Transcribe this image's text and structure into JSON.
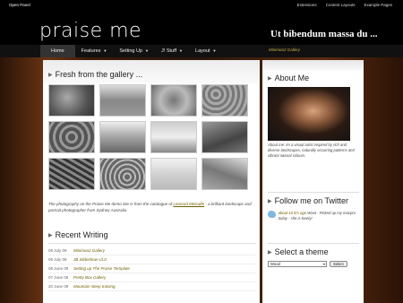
{
  "topbar": {
    "open_panel": "Open Panel",
    "links": [
      "Extensions",
      "Content Layouts",
      "Example Pages"
    ]
  },
  "header": {
    "logo": "praise me",
    "tagline": "Ut bibendum massa du ..."
  },
  "nav": {
    "items": [
      {
        "label": "Home",
        "active": true,
        "dropdown": false
      },
      {
        "label": "Features",
        "active": false,
        "dropdown": true
      },
      {
        "label": "Setting Up",
        "active": false,
        "dropdown": true
      },
      {
        "label": "J! Stuff",
        "active": false,
        "dropdown": true
      },
      {
        "label": "Layout",
        "active": false,
        "dropdown": true
      }
    ],
    "breadcrumb": "Minimoo2 Gallery"
  },
  "main": {
    "gallery_title": "Fresh from the gallery ...",
    "description_before": "The photography on the Praise Me demo site is from the catalogue of ",
    "description_link": "Leonard Metcalfe",
    "description_after": " - a brilliant landscape and portrait photographer from Sydney Australia.",
    "recent_title": "Recent Writing",
    "posts": [
      {
        "date": "09 July 09",
        "title": "Minimoo2 Gallery"
      },
      {
        "date": "09 July 09",
        "title": "JB Slideshow v3.0"
      },
      {
        "date": "08 June 09",
        "title": "Setting up The Praise Template"
      },
      {
        "date": "07 June 09",
        "title": "Pretty Box Gallery"
      },
      {
        "date": "20 June 09",
        "title": "Mountain sleep training"
      }
    ]
  },
  "sidebar": {
    "about_title": "About Me",
    "about_text": "About me: Im a visual artist inspired by rich and diverse landscapes, naturally occurring patterns and vibrant natural colours.",
    "twitter_title": "Follow me on Twitter",
    "tweet_time": "about 10 hrs ago",
    "tweet_text": "Woot - Picked up my macpro today - she is lovely!",
    "theme_title": "Select a theme",
    "theme_selected": "Wood",
    "theme_button": "Select"
  },
  "colors": {
    "link_olive": "#6e5f00",
    "header_black": "#000000",
    "wood_brown": "#5c2c10"
  }
}
